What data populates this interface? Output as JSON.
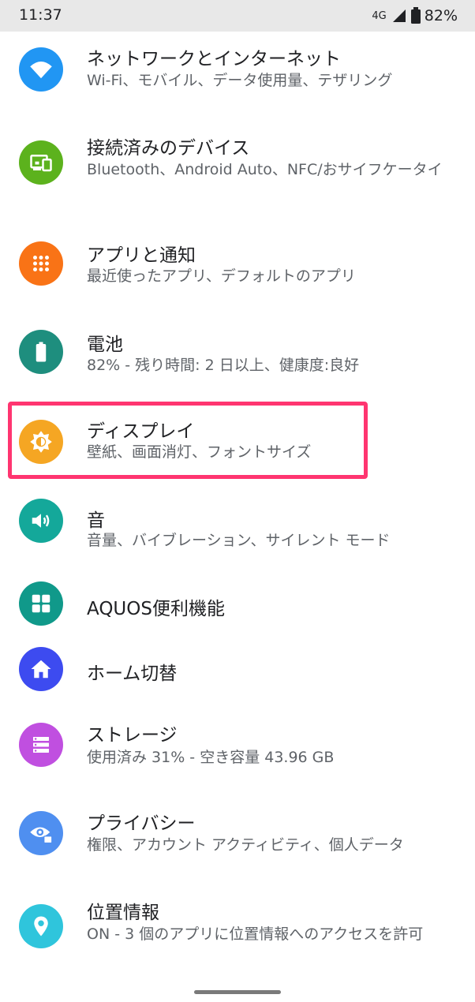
{
  "status_bar": {
    "time": "11:37",
    "network": "4G",
    "battery": "82%"
  },
  "settings": [
    {
      "title": "ネットワークとインターネット",
      "subtitle": "Wi-Fi、モバイル、データ使用量、テザリング",
      "icon": "wifi-icon",
      "color": "#2196f3"
    },
    {
      "title": "接続済みのデバイス",
      "subtitle": "Bluetooth、Android Auto、NFC/おサイフケータイ",
      "icon": "devices-icon",
      "color": "#5cb21d"
    },
    {
      "title": "アプリと通知",
      "subtitle": "最近使ったアプリ、デフォルトのアプリ",
      "icon": "apps-icon",
      "color": "#f97316"
    },
    {
      "title": "電池",
      "subtitle": "82% - 残り時間: 2 日以上、健康度:良好",
      "icon": "battery-icon",
      "color": "#1e8e7e"
    },
    {
      "title": "ディスプレイ",
      "subtitle": "壁紙、画面消灯、フォントサイズ",
      "icon": "brightness-icon",
      "color": "#f5a623"
    },
    {
      "title": "音",
      "subtitle": "音量、バイブレーション、サイレント モード",
      "icon": "volume-icon",
      "color": "#14a89a"
    },
    {
      "title": "AQUOS便利機能",
      "subtitle": "",
      "icon": "grid-icon",
      "color": "#10998a"
    },
    {
      "title": "ホーム切替",
      "subtitle": "",
      "icon": "home-icon",
      "color": "#3d4bf0"
    },
    {
      "title": "ストレージ",
      "subtitle": "使用済み 31% - 空き容量 43.96 GB",
      "icon": "storage-icon",
      "color": "#c04fe0"
    },
    {
      "title": "プライバシー",
      "subtitle": "権限、アカウント アクティビティ、個人データ",
      "icon": "privacy-icon",
      "color": "#4f8ff0"
    },
    {
      "title": "位置情報",
      "subtitle": "ON - 3 個のアプリに位置情報へのアクセスを許可",
      "icon": "location-icon",
      "color": "#2fc5dc"
    }
  ]
}
